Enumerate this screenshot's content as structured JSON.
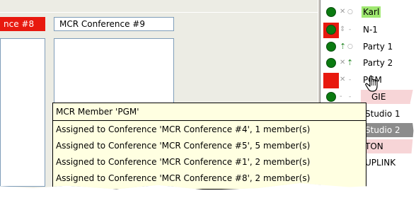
{
  "conferences": {
    "left_header": "nce #8",
    "right_header": "MCR Conference #9"
  },
  "members": [
    {
      "label": "Karl",
      "status_icon": "green-dot",
      "route_icon": "x-icon",
      "highlight": "green"
    },
    {
      "label": "N-1",
      "status_icon": "red-square-green-dot",
      "route_icon": "up-down-arrow-icon"
    },
    {
      "label": "Party 1",
      "status_icon": "green-dot",
      "route_icon": "up-arrow-icon"
    },
    {
      "label": "Party 2",
      "status_icon": "green-dot",
      "route_icon": "up-arrow-icon"
    },
    {
      "label": "PGM",
      "status_icon": "red-square-hand",
      "route_icon": "x-icon"
    },
    {
      "label": "GIE",
      "status_icon": "green-dot",
      "route_icon": "dash-icon",
      "highlight": "pink"
    },
    {
      "label": "Studio 1",
      "status_icon": "",
      "route_icon": ""
    },
    {
      "label": "Studio 2",
      "status_icon": "",
      "route_icon": "",
      "highlight": "gray"
    },
    {
      "label": "TON",
      "status_icon": "",
      "route_icon": "",
      "highlight": "pink"
    },
    {
      "label": "UPLINK",
      "status_icon": "",
      "route_icon": ""
    }
  ],
  "tooltip": {
    "title": "MCR Member 'PGM'",
    "lines": [
      "Assigned to Conference 'MCR Conference #4', 1 member(s)",
      "Assigned to Conference 'MCR Conference #5', 5 member(s)",
      "Assigned to Conference 'MCR Conference #1', 2 member(s)",
      "Assigned to Conference 'MCR Conference #8', 2 member(s)"
    ]
  },
  "colors": {
    "active_conference": "#e8190f",
    "member_online": "#0a7a10",
    "tooltip_bg": "#ffffe1",
    "highlight_pink": "#f7d5d7",
    "highlight_green": "#9fe870"
  }
}
